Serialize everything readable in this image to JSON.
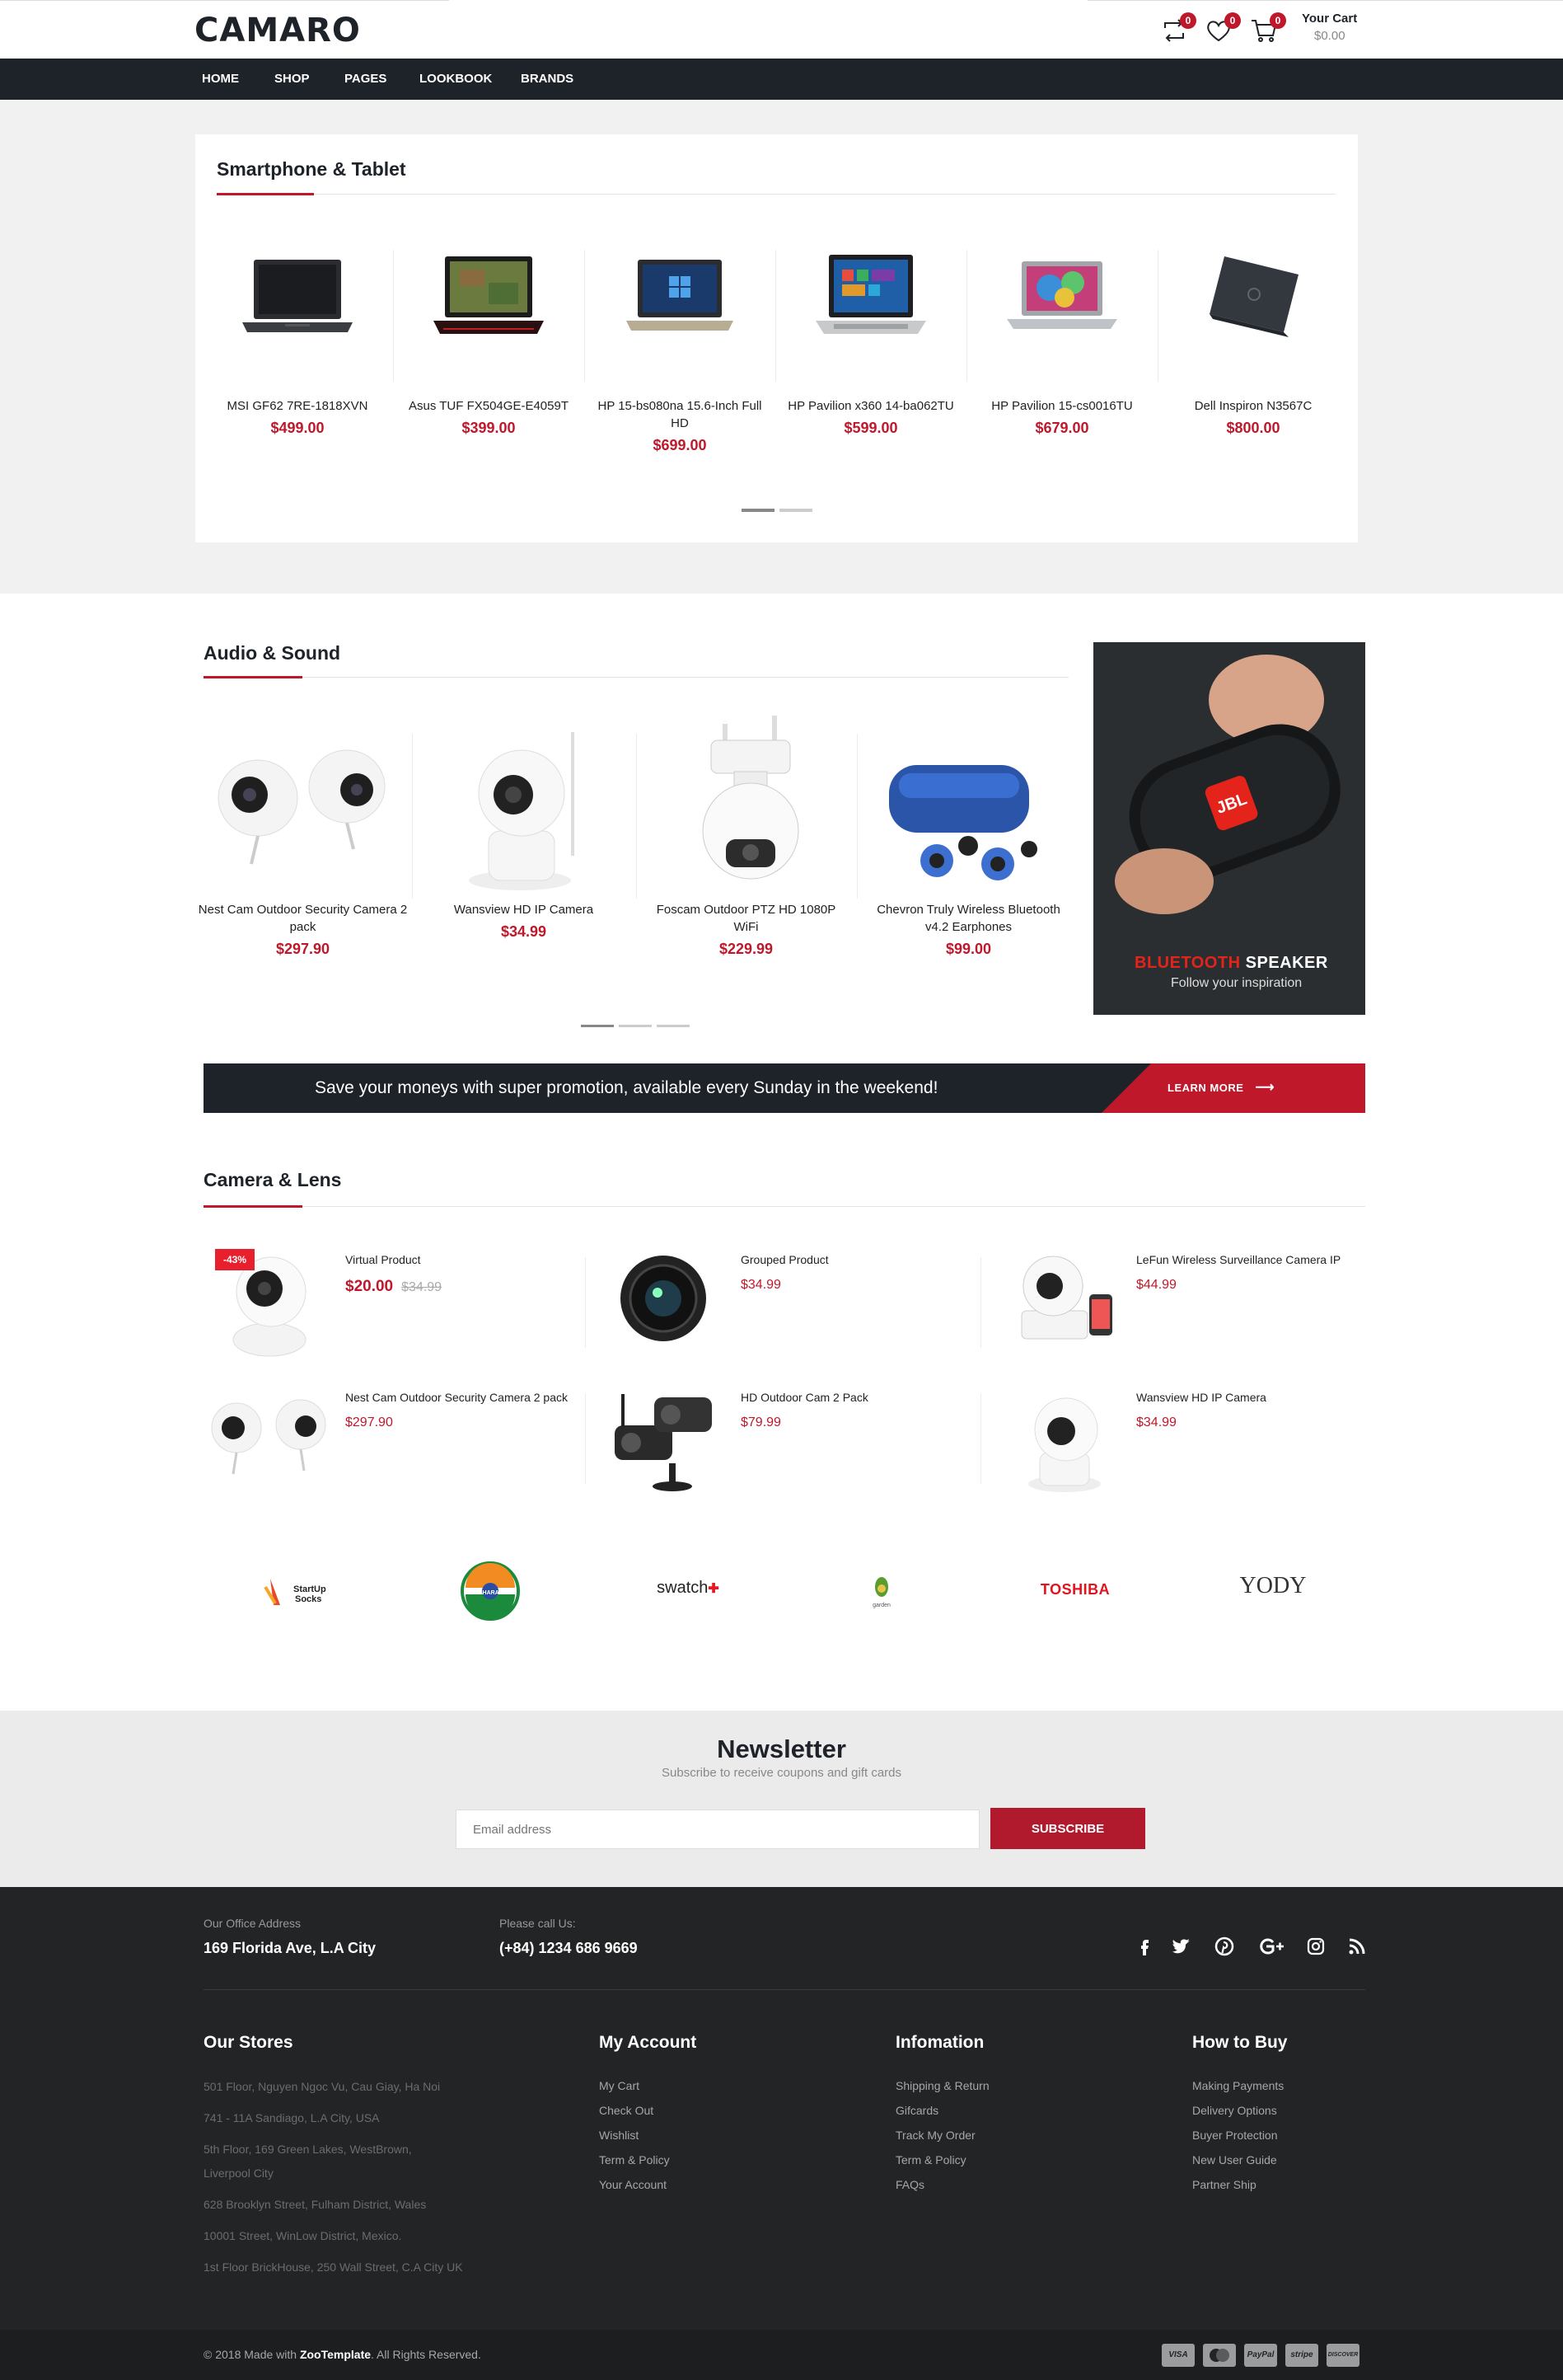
{
  "header": {
    "logo": "CAMARO",
    "compare_count": "0",
    "wishlist_count": "0",
    "cart_count": "0",
    "cart_title": "Your Cart",
    "cart_total": "$0.00"
  },
  "nav": [
    "HOME",
    "SHOP",
    "PAGES",
    "LOOKBOOK",
    "BRANDS"
  ],
  "smartphone": {
    "title": "Smartphone & Tablet",
    "products": [
      {
        "name": "MSI GF62 7RE-1818XVN",
        "price": "$499.00",
        "image": "laptop-icon"
      },
      {
        "name": "Asus TUF FX504GE-E4059T",
        "price": "$399.00",
        "image": "laptop-icon"
      },
      {
        "name": "HP 15-bs080na 15.6-Inch Full HD",
        "price": "$699.00",
        "image": "laptop-icon"
      },
      {
        "name": "HP Pavilion x360 14-ba062TU",
        "price": "$599.00",
        "image": "laptop-icon"
      },
      {
        "name": "HP Pavilion 15-cs0016TU",
        "price": "$679.00",
        "image": "laptop-icon"
      },
      {
        "name": "Dell Inspiron N3567C",
        "price": "$800.00",
        "image": "laptop-icon"
      }
    ]
  },
  "audio": {
    "title": "Audio & Sound",
    "products": [
      {
        "name": "Nest Cam Outdoor Security Camera 2 pack",
        "price": "$297.90"
      },
      {
        "name": "Wansview HD IP Camera",
        "price": "$34.99"
      },
      {
        "name": "Foscam Outdoor PTZ HD 1080P WiFi",
        "price": "$229.99"
      },
      {
        "name": "Chevron Truly Wireless Bluetooth v4.2 Earphones",
        "price": "$99.00"
      }
    ],
    "banner": {
      "title_accent": "BLUETOOTH",
      "title_rest": "SPEAKER",
      "subtitle": "Follow your inspiration",
      "logo": "JBL"
    }
  },
  "promo": {
    "text": "Save your moneys with super promotion, available every Sunday in the weekend!",
    "button": "LEARN MORE"
  },
  "camera": {
    "title": "Camera & Lens",
    "items": [
      {
        "name": "Virtual Product",
        "price": "$20.00",
        "old_price": "$34.99",
        "badge": "-43%"
      },
      {
        "name": "Grouped Product",
        "price": "$34.99"
      },
      {
        "name": "LeFun Wireless Surveillance Camera IP",
        "price": "$44.99"
      },
      {
        "name": "Nest Cam Outdoor Security Camera 2 pack",
        "price": "$297.90"
      },
      {
        "name": "HD Outdoor Cam 2 Pack",
        "price": "$79.99"
      },
      {
        "name": "Wansview HD IP Camera",
        "price": "$34.99"
      }
    ]
  },
  "brands": [
    "StartUp Socks",
    "BHARAT",
    "swatch",
    "garden",
    "TOSHIBA",
    "YODY"
  ],
  "newsletter": {
    "title": "Newsletter",
    "subtitle": "Subscribe to receive coupons and gift cards",
    "placeholder": "Email address",
    "button": "SUBSCRIBE"
  },
  "footer": {
    "office_label": "Our Office Address",
    "office_value": "169 Florida Ave, L.A City",
    "phone_label": "Please call Us:",
    "phone_value": "(+84) 1234 686 9669",
    "social": [
      "facebook-icon",
      "twitter-icon",
      "pinterest-icon",
      "google-plus-icon",
      "instagram-icon",
      "rss-icon"
    ],
    "stores_title": "Our Stores",
    "stores": [
      "501 Floor, Nguyen Ngoc Vu, Cau Giay, Ha Noi",
      "741 - 11A Sandiago, L.A City, USA",
      "5th Floor, 169 Green Lakes, WestBrown, Liverpool City",
      "628 Brooklyn Street, Fulham District, Wales",
      "10001 Street, WinLow District, Mexico.",
      "1st Floor BrickHouse, 250 Wall Street, C.A City UK"
    ],
    "account_title": "My Account",
    "account_links": [
      "My Cart",
      "Check Out",
      "Wishlist",
      "Term & Policy",
      "Your Account"
    ],
    "info_title": "Infomation",
    "info_links": [
      "Shipping & Return",
      "Gifcards",
      "Track My Order",
      "Term & Policy",
      "FAQs"
    ],
    "buy_title": "How to Buy",
    "buy_links": [
      "Making Payments",
      "Delivery Options",
      "Buyer Protection",
      "New User Guide",
      "Partner Ship"
    ],
    "copyright_pre": "© 2018 Made with",
    "copyright_brand": "ZooTemplate",
    "copyright_post": ". All Rights Reserved.",
    "payments": [
      "VISA",
      "MC",
      "PayPal",
      "stripe",
      "DISCOVER"
    ]
  },
  "colors": {
    "accent": "#c0182b",
    "dark": "#1e2229",
    "footer": "#232425"
  }
}
